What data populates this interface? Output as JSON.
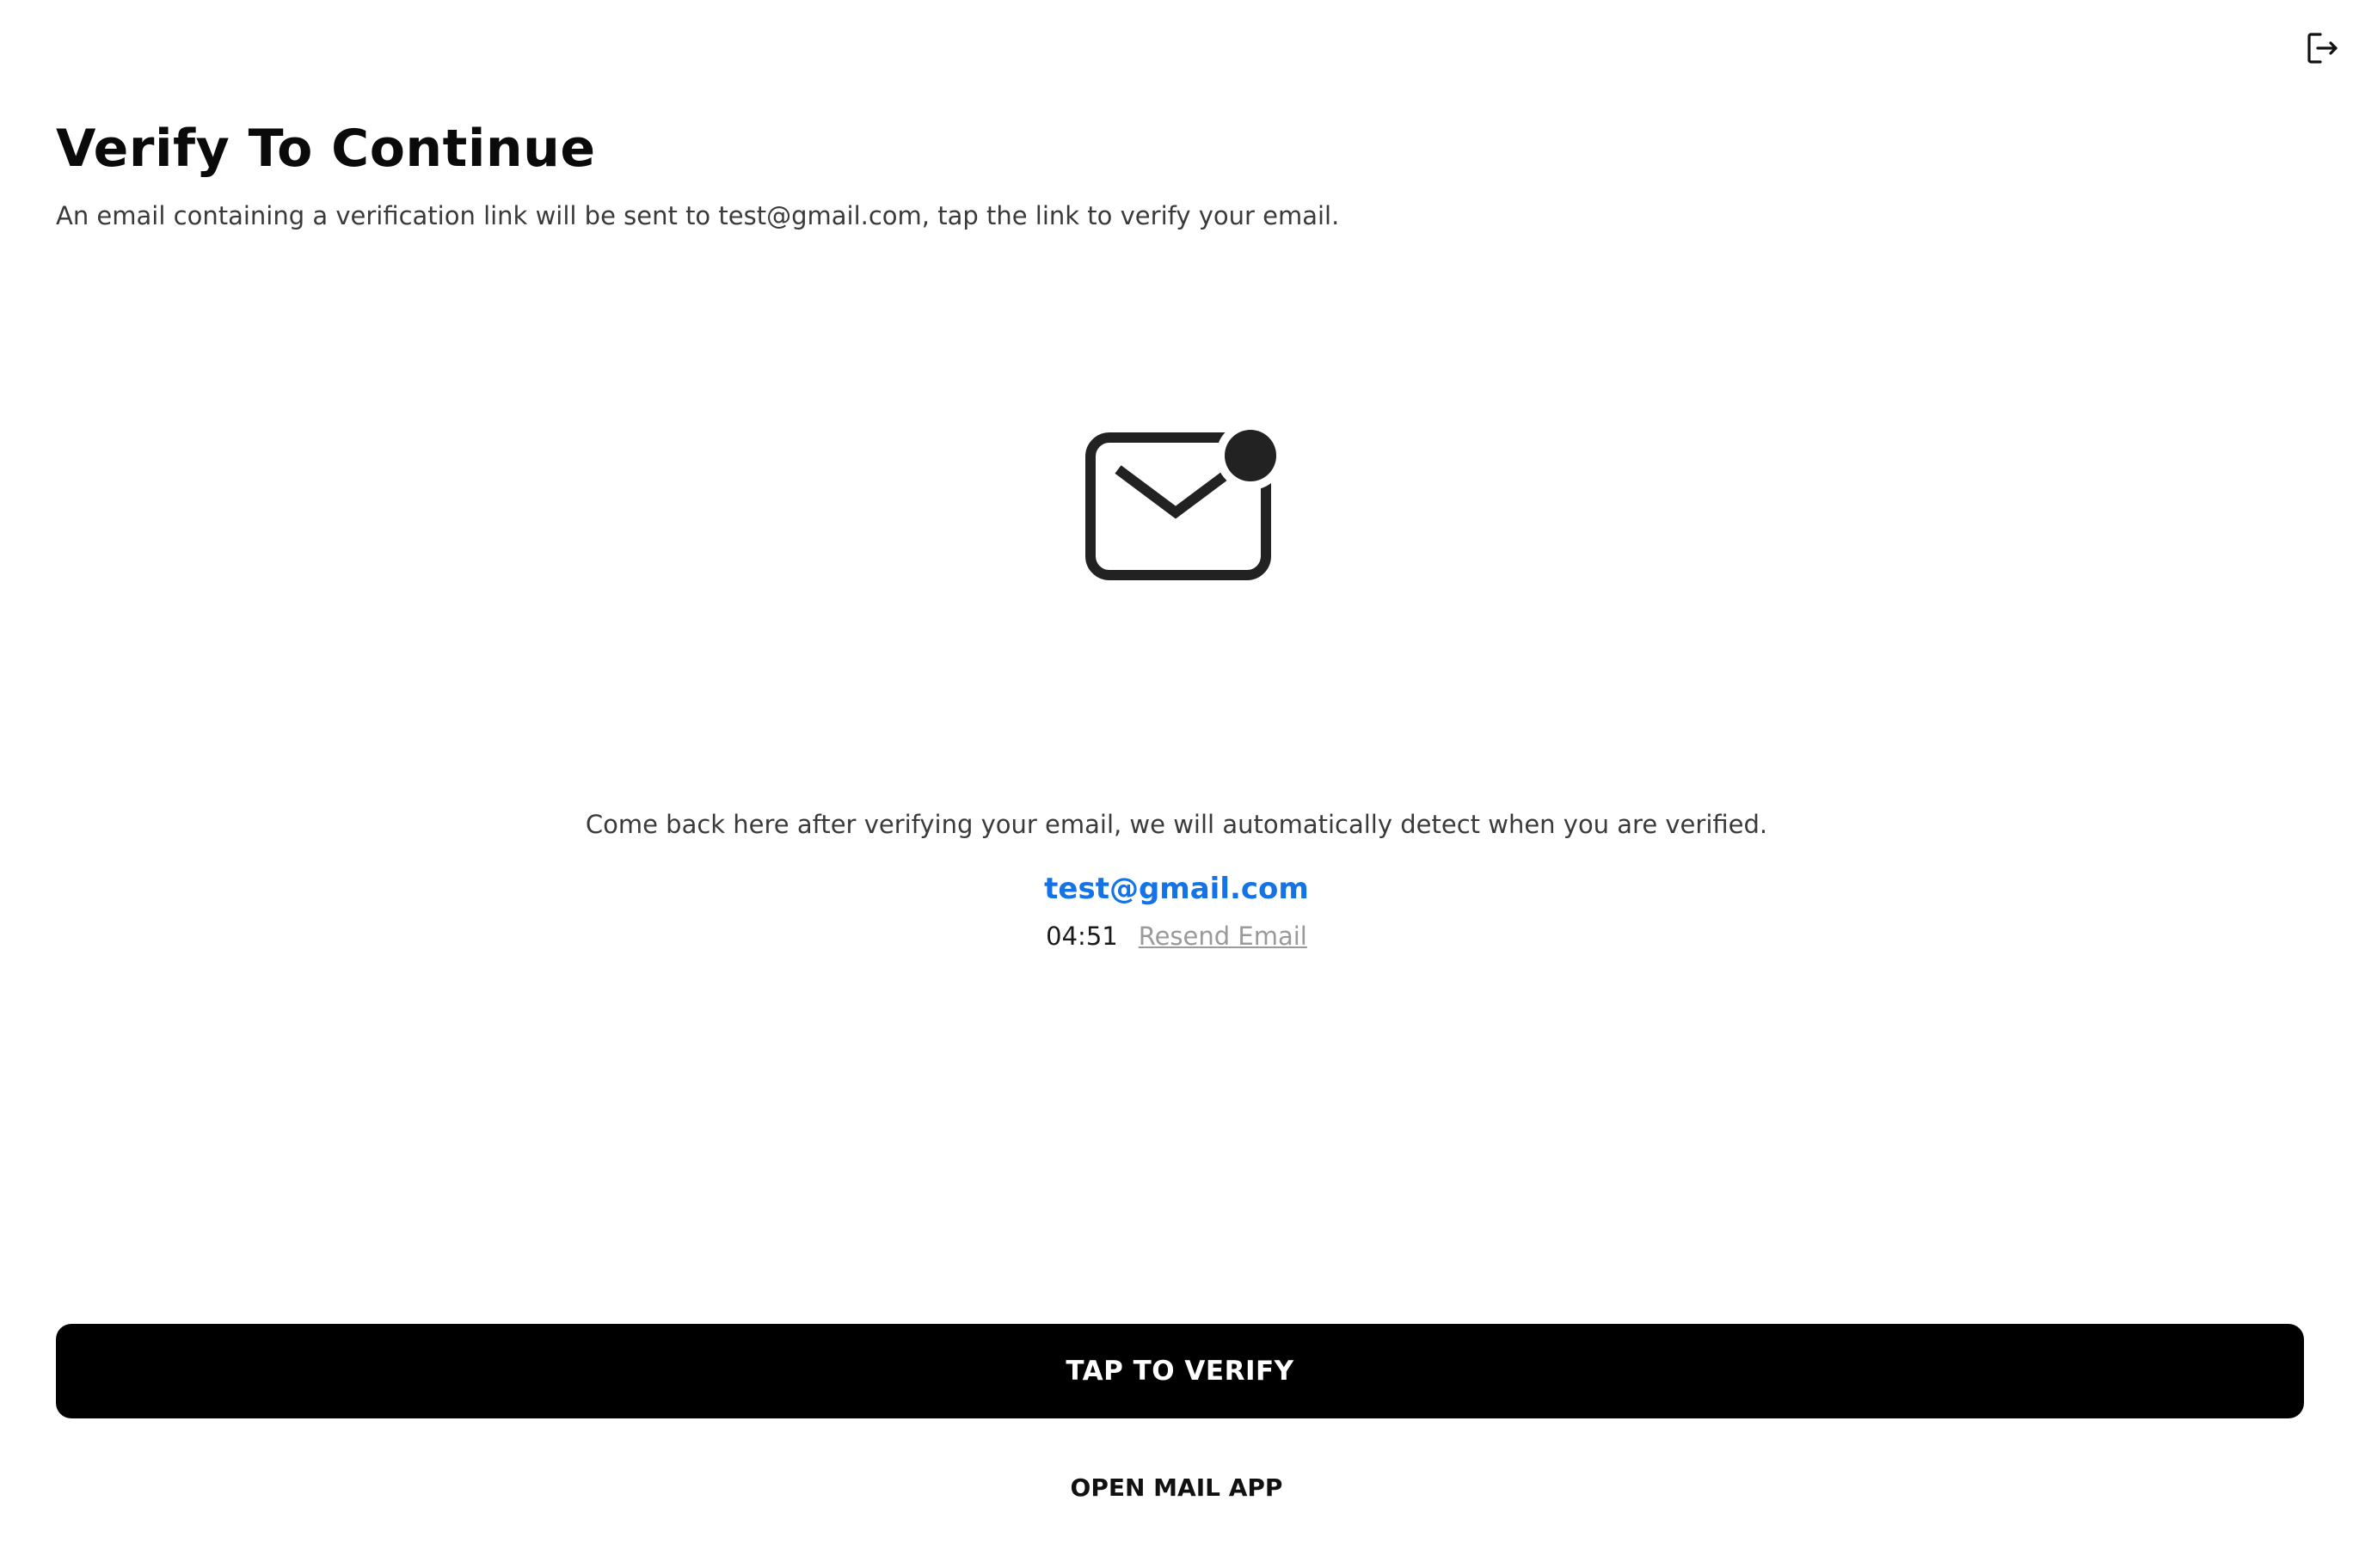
{
  "header": {
    "logout_icon": "logout-icon"
  },
  "main": {
    "title": "Verify To Continue",
    "subtitle": "An email containing a verification link will be sent to test@gmail.com, tap the link to verify your email.",
    "illustration_icon": "mail-unread-icon",
    "info_text": "Come back here after verifying your email, we will automatically detect when you are verified.",
    "email": "test@gmail.com",
    "timer": "04:51",
    "resend_label": "Resend Email"
  },
  "actions": {
    "verify_label": "TAP TO VERIFY",
    "open_mail_label": "OPEN MAIL APP"
  },
  "colors": {
    "email_link": "#1473e6",
    "primary_button": "#000000",
    "resend_disabled": "#9a9a9a"
  }
}
